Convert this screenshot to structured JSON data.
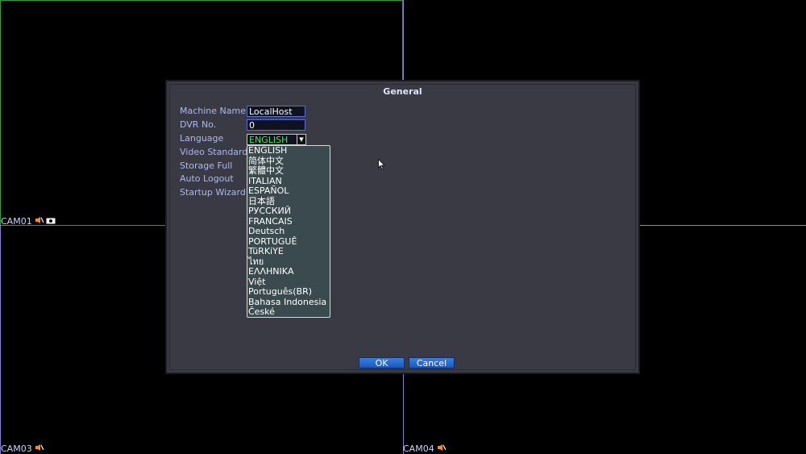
{
  "cameras": [
    {
      "label": "CAM01"
    },
    {
      "label": "CAM03"
    },
    {
      "label": "CAM04"
    }
  ],
  "colors": {
    "grid_green": "#2e9e3a",
    "grid_purple": "#8b7fd6",
    "accent_field": "#46e64a"
  },
  "icons": {
    "cam_icons": [
      "speaker-muted-icon",
      "camera-icon"
    ]
  },
  "dialog": {
    "title": "General",
    "fields": {
      "machine_name_label": "Machine Name",
      "machine_name_value": "LocalHost",
      "dvr_no_label": "DVR No.",
      "dvr_no_value": "0",
      "language_label": "Language",
      "language_value": "ENGLISH",
      "video_standard_label": "Video Standard",
      "storage_full_label": "Storage Full",
      "auto_logout_label": "Auto Logout",
      "startup_wizard_label": "Startup Wizard"
    },
    "language_options": [
      "ENGLISH",
      "简体中文",
      "繁體中文",
      "ITALIAN",
      "ESPAÑOL",
      "日本語",
      "РУССКИЙ",
      "FRANCAIS",
      "Deutsch",
      "PORTUGUÊ",
      "TüRKiYE",
      "ไทย",
      "ΕΛΛΗΝΙΚΑ",
      "Việt",
      "Português(BR)",
      "Bahasa Indonesia",
      "České"
    ],
    "ok_label": "OK",
    "cancel_label": "Cancel"
  }
}
